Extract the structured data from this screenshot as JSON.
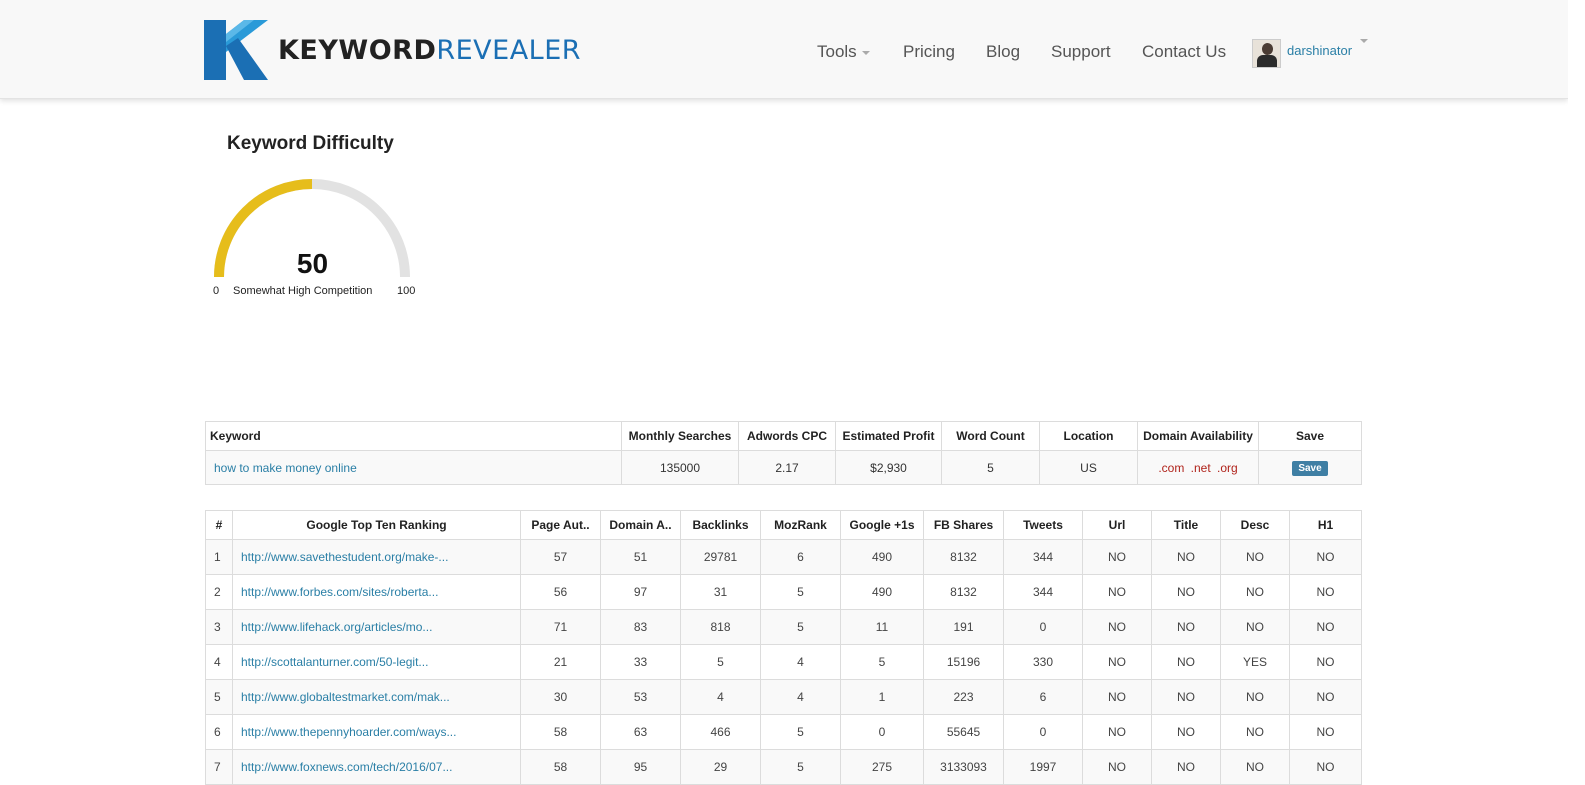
{
  "brand": {
    "name_bold": "KEYWORD",
    "name_light": "REVEALER"
  },
  "nav": {
    "tools": "Tools",
    "pricing": "Pricing",
    "blog": "Blog",
    "support": "Support",
    "contact": "Contact Us",
    "username": "darshinator"
  },
  "difficulty": {
    "title": "Keyword Difficulty",
    "value": 50,
    "min": "0",
    "max": "100",
    "label": "Somewhat High Competition",
    "fill_color": "#e6bd1b",
    "track_color": "#e2e2e2"
  },
  "keyword_table": {
    "headers": [
      "Keyword",
      "Monthly Searches",
      "Adwords CPC",
      "Estimated Profit",
      "Word Count",
      "Location",
      "Domain Availability",
      "Save"
    ],
    "row": {
      "keyword": "how to make money online",
      "monthly_searches": "135000",
      "cpc": "2.17",
      "profit": "$2,930",
      "word_count": "5",
      "location": "US",
      "domains": ".com .net .org",
      "save_label": "Save"
    }
  },
  "ranking_table": {
    "headers": [
      "#",
      "Google Top Ten Ranking",
      "Page Aut..",
      "Domain A..",
      "Backlinks",
      "MozRank",
      "Google +1s",
      "FB Shares",
      "Tweets",
      "Url",
      "Title",
      "Desc",
      "H1"
    ],
    "rows": [
      [
        "1",
        "http://www.savethestudent.org/make-...",
        "57",
        "51",
        "29781",
        "6",
        "490",
        "8132",
        "344",
        "NO",
        "NO",
        "NO",
        "NO"
      ],
      [
        "2",
        "http://www.forbes.com/sites/roberta...",
        "56",
        "97",
        "31",
        "5",
        "490",
        "8132",
        "344",
        "NO",
        "NO",
        "NO",
        "NO"
      ],
      [
        "3",
        "http://www.lifehack.org/articles/mo...",
        "71",
        "83",
        "818",
        "5",
        "11",
        "191",
        "0",
        "NO",
        "NO",
        "NO",
        "NO"
      ],
      [
        "4",
        "http://scottalanturner.com/50-legit...",
        "21",
        "33",
        "5",
        "4",
        "5",
        "15196",
        "330",
        "NO",
        "NO",
        "YES",
        "NO"
      ],
      [
        "5",
        "http://www.globaltestmarket.com/mak...",
        "30",
        "53",
        "4",
        "4",
        "1",
        "223",
        "6",
        "NO",
        "NO",
        "NO",
        "NO"
      ],
      [
        "6",
        "http://www.thepennyhoarder.com/ways...",
        "58",
        "63",
        "466",
        "5",
        "0",
        "55645",
        "0",
        "NO",
        "NO",
        "NO",
        "NO"
      ],
      [
        "7",
        "http://www.foxnews.com/tech/2016/07...",
        "58",
        "95",
        "29",
        "5",
        "275",
        "3133093",
        "1997",
        "NO",
        "NO",
        "NO",
        "NO"
      ]
    ]
  }
}
